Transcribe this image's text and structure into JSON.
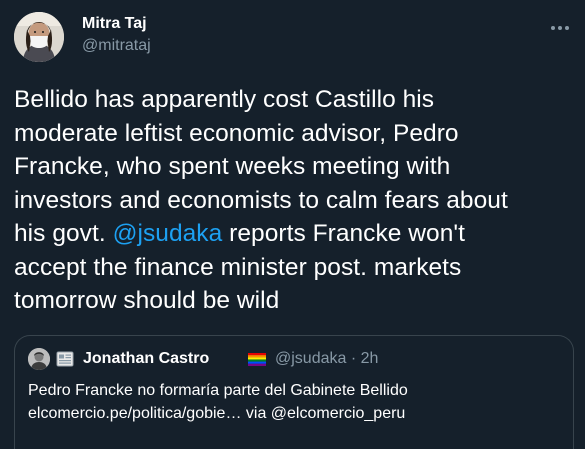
{
  "tweet": {
    "author": {
      "name": "Mitra Taj",
      "handle": "@mitrataj"
    },
    "icons": {
      "more": "more-horizontal-icon"
    },
    "text_lines": [
      {
        "segments": [
          {
            "text": "Bellido has apparently cost Castillo his"
          }
        ]
      },
      {
        "segments": [
          {
            "text": "moderate leftist economic advisor, Pedro"
          }
        ]
      },
      {
        "segments": [
          {
            "text": "Francke, who spent weeks meeting with"
          }
        ]
      },
      {
        "segments": [
          {
            "text": "investors and economists to calm fears about"
          }
        ]
      },
      {
        "segments": [
          {
            "text": "his govt. "
          },
          {
            "text": "@jsudaka",
            "mention": true
          },
          {
            "text": " reports Francke won't"
          }
        ]
      },
      {
        "segments": [
          {
            "text": "accept the finance minister post. markets"
          }
        ]
      },
      {
        "segments": [
          {
            "text": "tomorrow should be wild"
          }
        ]
      }
    ]
  },
  "quote": {
    "author": {
      "name": "Jonathan Castro",
      "handle": "@jsudaka",
      "separator": "·",
      "time": "2h"
    },
    "icons": {
      "news": "newspaper-icon",
      "flag": "rainbow-flag-icon"
    },
    "body_lines": [
      "Pedro Francke no formaría parte del Gabinete Bellido",
      "elcomercio.pe/politica/gobie… via @elcomercio_peru"
    ]
  },
  "colors": {
    "background": "#15202b",
    "text": "#ffffff",
    "secondary": "#8899a6",
    "accent": "#1da1f2",
    "border": "#38444d"
  }
}
